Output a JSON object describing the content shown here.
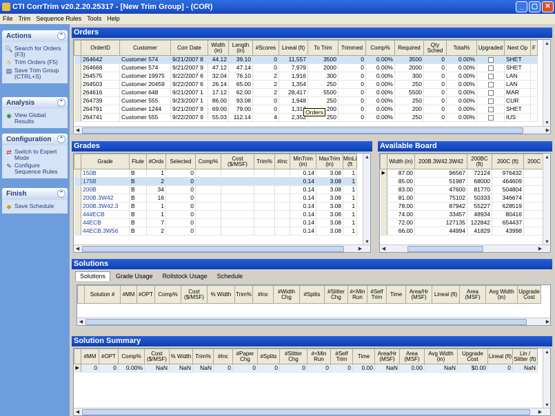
{
  "window": {
    "title": "CTI CorrTrim v20.2.20.25317 - [New Trim Group] - (COR)",
    "min": "_",
    "max": "▢",
    "close": "✕"
  },
  "menu": [
    "File",
    "Trim",
    "Sequence Rules",
    "Tools",
    "Help"
  ],
  "left": {
    "actions": {
      "title": "Actions",
      "items": [
        "Search for Orders (F3)",
        "Trim Orders (F5)",
        "Save Trim Group (CTRL+S)"
      ]
    },
    "analysis": {
      "title": "Analysis",
      "items": [
        "View Global Results"
      ]
    },
    "configuration": {
      "title": "Configuration",
      "items": [
        "Switch to Expert Mode",
        "Configure Sequence Rules"
      ]
    },
    "finish": {
      "title": "Finish",
      "items": [
        "Save Schedule"
      ]
    }
  },
  "orders": {
    "title": "Orders",
    "columns": [
      "OrderID",
      "Customer",
      "Corr Date",
      "Width (in)",
      "Length (in)",
      "#Scores",
      "Lineal (ft)",
      "To Trim",
      "Trimmed",
      "Comp%",
      "Required",
      "Qty Sched",
      "Total%",
      "Upgraded",
      "Next Op",
      "F"
    ],
    "rows": [
      [
        "264642",
        "Customer 574",
        "9/21/2007 8",
        "44.12",
        "39.10",
        "0",
        "11,557",
        "3500",
        "0",
        "0.00%",
        "3500",
        "0",
        "0.00%",
        "",
        "SHET"
      ],
      [
        "264668",
        "Customer 574",
        "9/21/2007 9",
        "47.12",
        "47.14",
        "0",
        "7,979",
        "2000",
        "0",
        "0.00%",
        "2000",
        "0",
        "0.00%",
        "",
        "SHET"
      ],
      [
        "264575",
        "Customer 19975",
        "9/22/2007 6",
        "32.04",
        "76.10",
        "2",
        "1,916",
        "300",
        "0",
        "0.00%",
        "300",
        "0",
        "0.00%",
        "",
        "LAN"
      ],
      [
        "264503",
        "Customer 20459",
        "9/22/2007 6",
        "26.14",
        "65.00",
        "2",
        "1,354",
        "250",
        "0",
        "0.00%",
        "250",
        "0",
        "0.00%",
        "",
        "LAN"
      ],
      [
        "264616",
        "Customer 648",
        "9/21/2007 1",
        "17.12",
        "62.00",
        "2",
        "28,417",
        "5500",
        "0",
        "0.00%",
        "5500",
        "0",
        "0.00%",
        "",
        "MAR"
      ],
      [
        "264739",
        "Customer 555",
        "9/23/2007 1",
        "86.00",
        "93.08",
        "0",
        "1,948",
        "250",
        "0",
        "0.00%",
        "250",
        "0",
        "0.00%",
        "",
        "CUR"
      ],
      [
        "264791",
        "Customer 1244",
        "9/21/2007 9",
        "69.00",
        "79.00",
        "0",
        "1,317",
        "200",
        "0",
        "0.00%",
        "200",
        "0",
        "0.00%",
        "",
        "SHET"
      ],
      [
        "264741",
        "Customer 555",
        "9/22/2007 9",
        "55.03",
        "112.14",
        "4",
        "2,352",
        "250",
        "0",
        "0.00%",
        "250",
        "0",
        "0.00%",
        "",
        "IUS"
      ]
    ],
    "tooltip": "Orders"
  },
  "grades": {
    "title": "Grades",
    "columns": [
      "Grade",
      "Flute",
      "#Ords",
      "Selected",
      "Comp%",
      "Cost ($/MSF)",
      "Trim%",
      "#Inc",
      "MinTrim (in)",
      "MaxTrim (in)",
      "MinLi (ft"
    ],
    "rows": [
      [
        "150B",
        "B",
        "1",
        "0",
        "",
        "",
        "",
        "",
        "0.14",
        "3.08",
        "1"
      ],
      [
        "175B",
        "B",
        "2",
        "0",
        "",
        "",
        "",
        "",
        "0.14",
        "3.08",
        "1"
      ],
      [
        "200B",
        "B",
        "34",
        "0",
        "",
        "",
        "",
        "",
        "0.14",
        "3.08",
        "1"
      ],
      [
        "200B.3W42",
        "B",
        "16",
        "0",
        "",
        "",
        "",
        "",
        "0.14",
        "3.08",
        "1"
      ],
      [
        "200B.3W42.3",
        "B",
        "1",
        "0",
        "",
        "",
        "",
        "",
        "0.14",
        "3.08",
        "1"
      ],
      [
        "44#ECB",
        "B",
        "1",
        "0",
        "",
        "",
        "",
        "",
        "0.14",
        "3.08",
        "1"
      ],
      [
        "44ECB",
        "B",
        "7",
        "0",
        "",
        "",
        "",
        "",
        "0.14",
        "3.08",
        "1"
      ],
      [
        "44ECB.3W56",
        "B",
        "2",
        "0",
        "",
        "",
        "",
        "",
        "0.14",
        "3.08",
        "1"
      ]
    ]
  },
  "board": {
    "title": "Available Board",
    "columns": [
      "Width (in)",
      "200B.3W42.3W42",
      "200BC (ft)",
      "200C (ft)",
      "200C"
    ],
    "rows": [
      [
        "87.00",
        "96567",
        "72124",
        "976432"
      ],
      [
        "85.00",
        "51987",
        "68000",
        "464609"
      ],
      [
        "83.00",
        "47600",
        "81770",
        "504804"
      ],
      [
        "81.00",
        "75102",
        "50333",
        "346674"
      ],
      [
        "78.00",
        "87942",
        "55227",
        "628519"
      ],
      [
        "74.00",
        "33457",
        "48934",
        "80416"
      ],
      [
        "72.00",
        "127135",
        "122842",
        "654437"
      ],
      [
        "66.00",
        "44994",
        "41829",
        "43998"
      ]
    ]
  },
  "solutions": {
    "title": "Solutions",
    "tabs": [
      "Solutions",
      "Grade Usage",
      "Rollstock Usage",
      "Schedule"
    ],
    "columns": [
      "Solution #",
      "#MM",
      "#OPT",
      "Comp%",
      "Cost ($/MSF)",
      "% Width",
      "Trim%",
      "#Inc",
      "#Width Chg",
      "#Splits",
      "#Slitter Chg",
      "#<Min Run",
      "#Self Trim",
      "Time",
      "Area/Hr (MSF)",
      "Lineal (ft)",
      "Area (MSF)",
      "Avg Width (in)",
      "Upgrade Cost"
    ]
  },
  "summary": {
    "title": "Solution Summary",
    "columns": [
      "#MM",
      "#OPT",
      "Comp%",
      "Cost ($/MSF)",
      "% Width",
      "Trim%",
      "#Inc",
      "#Paper Chg",
      "#Splits",
      "#Slitter Chg",
      "#<Min Run",
      "#Self Trim",
      "Time",
      "Area/Hr (MSF)",
      "Area (MSF)",
      "Avg Width (in)",
      "Upgrade Cost",
      "Lineal (ft)",
      "Lin / Slitter (ft)"
    ],
    "row": [
      "0",
      "0",
      "0.00%",
      "NaN",
      "NaN",
      "NaN",
      "0",
      "0",
      "0",
      "0",
      "0",
      "0",
      "0.00",
      "NaN",
      "0.00",
      "NaN",
      "$0.00",
      "0",
      "NaN"
    ]
  }
}
